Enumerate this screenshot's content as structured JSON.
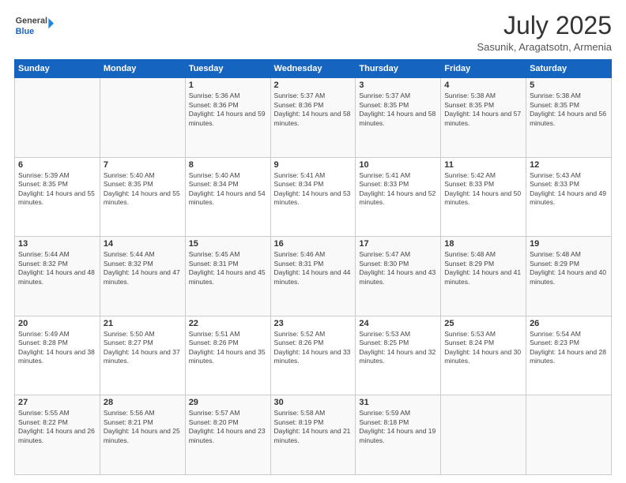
{
  "header": {
    "logo_line1": "General",
    "logo_line2": "Blue",
    "title": "July 2025",
    "subtitle": "Sasunik, Aragatsotn, Armenia"
  },
  "weekdays": [
    "Sunday",
    "Monday",
    "Tuesday",
    "Wednesday",
    "Thursday",
    "Friday",
    "Saturday"
  ],
  "weeks": [
    [
      {
        "day": "",
        "sunrise": "",
        "sunset": "",
        "daylight": ""
      },
      {
        "day": "",
        "sunrise": "",
        "sunset": "",
        "daylight": ""
      },
      {
        "day": "1",
        "sunrise": "Sunrise: 5:36 AM",
        "sunset": "Sunset: 8:36 PM",
        "daylight": "Daylight: 14 hours and 59 minutes."
      },
      {
        "day": "2",
        "sunrise": "Sunrise: 5:37 AM",
        "sunset": "Sunset: 8:36 PM",
        "daylight": "Daylight: 14 hours and 58 minutes."
      },
      {
        "day": "3",
        "sunrise": "Sunrise: 5:37 AM",
        "sunset": "Sunset: 8:35 PM",
        "daylight": "Daylight: 14 hours and 58 minutes."
      },
      {
        "day": "4",
        "sunrise": "Sunrise: 5:38 AM",
        "sunset": "Sunset: 8:35 PM",
        "daylight": "Daylight: 14 hours and 57 minutes."
      },
      {
        "day": "5",
        "sunrise": "Sunrise: 5:38 AM",
        "sunset": "Sunset: 8:35 PM",
        "daylight": "Daylight: 14 hours and 56 minutes."
      }
    ],
    [
      {
        "day": "6",
        "sunrise": "Sunrise: 5:39 AM",
        "sunset": "Sunset: 8:35 PM",
        "daylight": "Daylight: 14 hours and 55 minutes."
      },
      {
        "day": "7",
        "sunrise": "Sunrise: 5:40 AM",
        "sunset": "Sunset: 8:35 PM",
        "daylight": "Daylight: 14 hours and 55 minutes."
      },
      {
        "day": "8",
        "sunrise": "Sunrise: 5:40 AM",
        "sunset": "Sunset: 8:34 PM",
        "daylight": "Daylight: 14 hours and 54 minutes."
      },
      {
        "day": "9",
        "sunrise": "Sunrise: 5:41 AM",
        "sunset": "Sunset: 8:34 PM",
        "daylight": "Daylight: 14 hours and 53 minutes."
      },
      {
        "day": "10",
        "sunrise": "Sunrise: 5:41 AM",
        "sunset": "Sunset: 8:33 PM",
        "daylight": "Daylight: 14 hours and 52 minutes."
      },
      {
        "day": "11",
        "sunrise": "Sunrise: 5:42 AM",
        "sunset": "Sunset: 8:33 PM",
        "daylight": "Daylight: 14 hours and 50 minutes."
      },
      {
        "day": "12",
        "sunrise": "Sunrise: 5:43 AM",
        "sunset": "Sunset: 8:33 PM",
        "daylight": "Daylight: 14 hours and 49 minutes."
      }
    ],
    [
      {
        "day": "13",
        "sunrise": "Sunrise: 5:44 AM",
        "sunset": "Sunset: 8:32 PM",
        "daylight": "Daylight: 14 hours and 48 minutes."
      },
      {
        "day": "14",
        "sunrise": "Sunrise: 5:44 AM",
        "sunset": "Sunset: 8:32 PM",
        "daylight": "Daylight: 14 hours and 47 minutes."
      },
      {
        "day": "15",
        "sunrise": "Sunrise: 5:45 AM",
        "sunset": "Sunset: 8:31 PM",
        "daylight": "Daylight: 14 hours and 45 minutes."
      },
      {
        "day": "16",
        "sunrise": "Sunrise: 5:46 AM",
        "sunset": "Sunset: 8:31 PM",
        "daylight": "Daylight: 14 hours and 44 minutes."
      },
      {
        "day": "17",
        "sunrise": "Sunrise: 5:47 AM",
        "sunset": "Sunset: 8:30 PM",
        "daylight": "Daylight: 14 hours and 43 minutes."
      },
      {
        "day": "18",
        "sunrise": "Sunrise: 5:48 AM",
        "sunset": "Sunset: 8:29 PM",
        "daylight": "Daylight: 14 hours and 41 minutes."
      },
      {
        "day": "19",
        "sunrise": "Sunrise: 5:48 AM",
        "sunset": "Sunset: 8:29 PM",
        "daylight": "Daylight: 14 hours and 40 minutes."
      }
    ],
    [
      {
        "day": "20",
        "sunrise": "Sunrise: 5:49 AM",
        "sunset": "Sunset: 8:28 PM",
        "daylight": "Daylight: 14 hours and 38 minutes."
      },
      {
        "day": "21",
        "sunrise": "Sunrise: 5:50 AM",
        "sunset": "Sunset: 8:27 PM",
        "daylight": "Daylight: 14 hours and 37 minutes."
      },
      {
        "day": "22",
        "sunrise": "Sunrise: 5:51 AM",
        "sunset": "Sunset: 8:26 PM",
        "daylight": "Daylight: 14 hours and 35 minutes."
      },
      {
        "day": "23",
        "sunrise": "Sunrise: 5:52 AM",
        "sunset": "Sunset: 8:26 PM",
        "daylight": "Daylight: 14 hours and 33 minutes."
      },
      {
        "day": "24",
        "sunrise": "Sunrise: 5:53 AM",
        "sunset": "Sunset: 8:25 PM",
        "daylight": "Daylight: 14 hours and 32 minutes."
      },
      {
        "day": "25",
        "sunrise": "Sunrise: 5:53 AM",
        "sunset": "Sunset: 8:24 PM",
        "daylight": "Daylight: 14 hours and 30 minutes."
      },
      {
        "day": "26",
        "sunrise": "Sunrise: 5:54 AM",
        "sunset": "Sunset: 8:23 PM",
        "daylight": "Daylight: 14 hours and 28 minutes."
      }
    ],
    [
      {
        "day": "27",
        "sunrise": "Sunrise: 5:55 AM",
        "sunset": "Sunset: 8:22 PM",
        "daylight": "Daylight: 14 hours and 26 minutes."
      },
      {
        "day": "28",
        "sunrise": "Sunrise: 5:56 AM",
        "sunset": "Sunset: 8:21 PM",
        "daylight": "Daylight: 14 hours and 25 minutes."
      },
      {
        "day": "29",
        "sunrise": "Sunrise: 5:57 AM",
        "sunset": "Sunset: 8:20 PM",
        "daylight": "Daylight: 14 hours and 23 minutes."
      },
      {
        "day": "30",
        "sunrise": "Sunrise: 5:58 AM",
        "sunset": "Sunset: 8:19 PM",
        "daylight": "Daylight: 14 hours and 21 minutes."
      },
      {
        "day": "31",
        "sunrise": "Sunrise: 5:59 AM",
        "sunset": "Sunset: 8:18 PM",
        "daylight": "Daylight: 14 hours and 19 minutes."
      },
      {
        "day": "",
        "sunrise": "",
        "sunset": "",
        "daylight": ""
      },
      {
        "day": "",
        "sunrise": "",
        "sunset": "",
        "daylight": ""
      }
    ]
  ]
}
